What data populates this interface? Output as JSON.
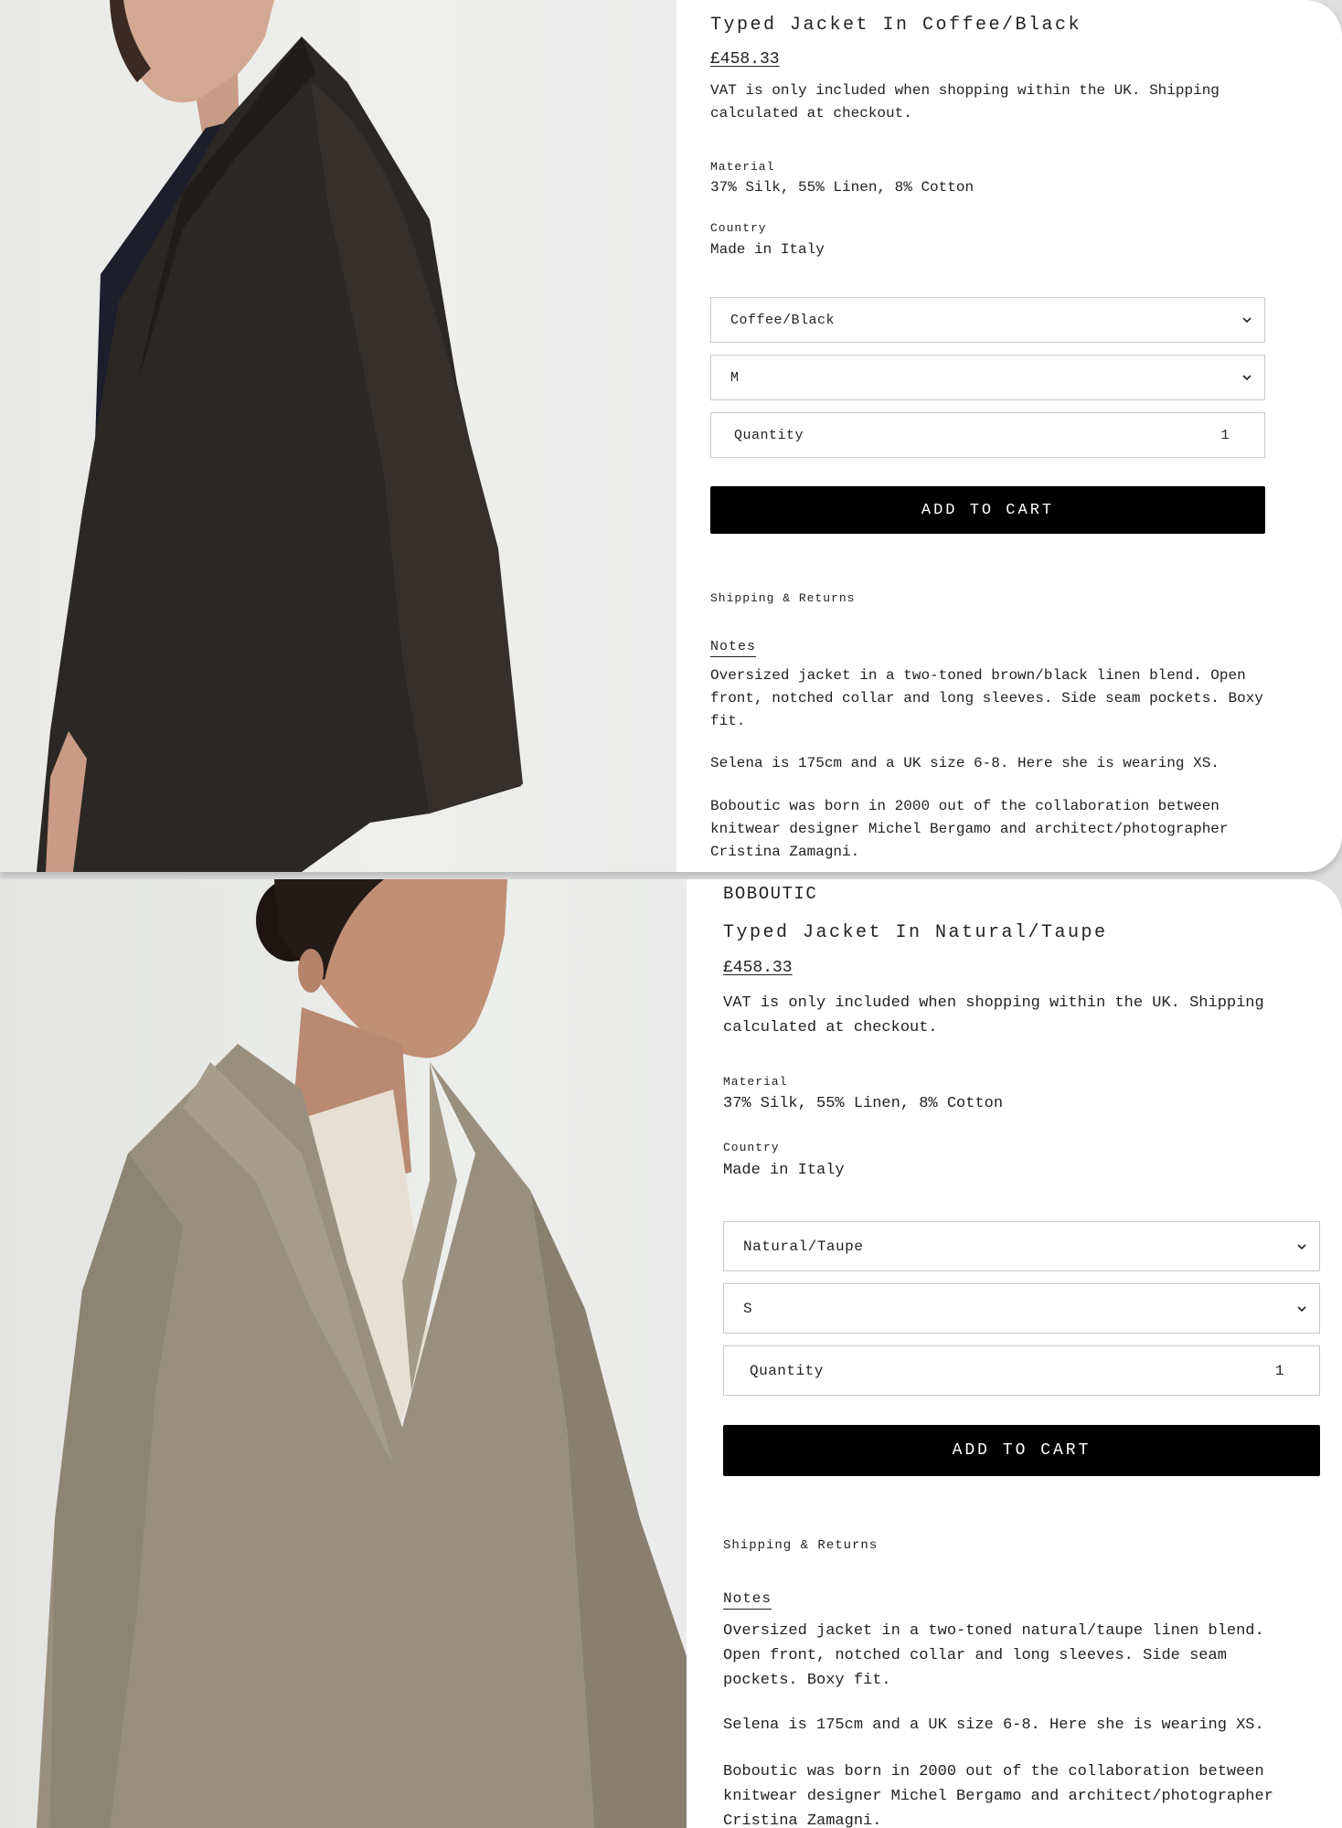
{
  "products": [
    {
      "vendor": "",
      "title": "Typed Jacket In Coffee/Black",
      "price": "£458.33",
      "vat_note": "VAT is only included when shopping within the UK. Shipping calculated at checkout.",
      "material_label": "Material",
      "material_value": "37% Silk, 55% Linen, 8% Cotton",
      "country_label": "Country",
      "country_value": "Made in Italy",
      "color_select": "Coffee/Black",
      "size_select": "M",
      "quantity_label": "Quantity",
      "quantity_value": "1",
      "add_to_cart": "ADD TO CART",
      "shipping_link": "Shipping & Returns",
      "notes_tab": "Notes",
      "notes_paragraphs": [
        "Oversized jacket in a two-toned brown/black linen blend. Open front, notched collar and long sleeves. Side seam pockets. Boxy fit.",
        "Selena is 175cm and a UK size 6-8. Here she is wearing XS.",
        "Boboutic was born in 2000 out of the collaboration between knitwear designer Michel Bergamo and architect/photographer Cristina Zamagni."
      ]
    },
    {
      "vendor": "BOBOUTIC",
      "title": "Typed Jacket In Natural/Taupe",
      "price": "£458.33",
      "vat_note": "VAT is only included when shopping within the UK. Shipping calculated at checkout.",
      "material_label": "Material",
      "material_value": "37% Silk, 55% Linen, 8% Cotton",
      "country_label": "Country",
      "country_value": "Made in Italy",
      "color_select": "Natural/Taupe",
      "size_select": "S",
      "quantity_label": "Quantity",
      "quantity_value": "1",
      "add_to_cart": "ADD TO CART",
      "shipping_link": "Shipping & Returns",
      "notes_tab": "Notes",
      "notes_paragraphs": [
        "Oversized jacket in a two-toned natural/taupe linen blend. Open front, notched collar and long sleeves. Side seam pockets. Boxy fit.",
        "Selena is 175cm and a UK size 6-8. Here she is wearing XS.",
        "Boboutic was born in 2000 out of the collaboration between knitwear designer Michel Bergamo and architect/photographer Cristina Zamagni."
      ]
    }
  ],
  "colors": {
    "button_bg": "#000000",
    "button_text": "#ffffff",
    "jacket_dark": "#2a2623",
    "jacket_light": "#9a8f7f"
  }
}
